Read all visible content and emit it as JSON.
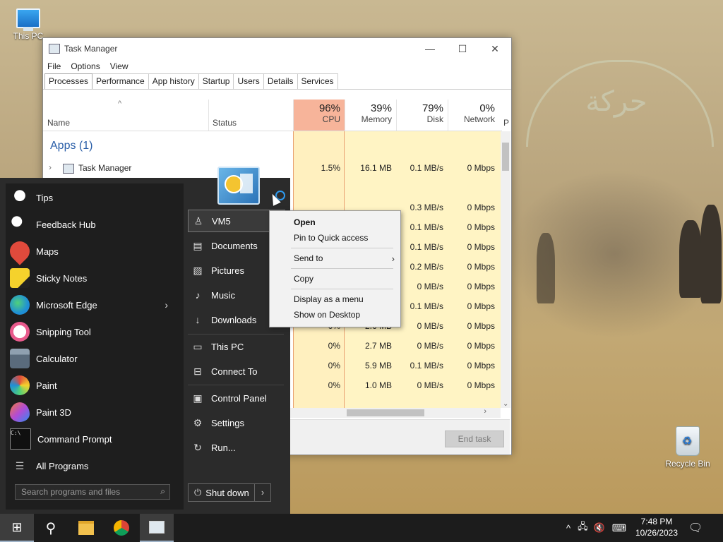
{
  "desktop": {
    "icons": [
      {
        "label": "This PC"
      },
      {
        "label": "Recycle Bin"
      }
    ]
  },
  "task_manager": {
    "title": "Task Manager",
    "menu": [
      "File",
      "Options",
      "View"
    ],
    "tabs": [
      "Processes",
      "Performance",
      "App history",
      "Startup",
      "Users",
      "Details",
      "Services"
    ],
    "columns": {
      "name": "Name",
      "status": "Status",
      "cpu": {
        "pct": "96%",
        "label": "CPU"
      },
      "memory": {
        "pct": "39%",
        "label": "Memory"
      },
      "disk": {
        "pct": "79%",
        "label": "Disk"
      },
      "network": {
        "pct": "0%",
        "label": "Network"
      },
      "partial": "P"
    },
    "apps_header": "Apps (1)",
    "rows": [
      {
        "name": "Task Manager",
        "cpu": "1.5%",
        "memory": "16.1 MB",
        "disk": "0.1 MB/s",
        "network": "0 Mbps"
      },
      {
        "name": "",
        "cpu": "",
        "memory": "",
        "disk": "",
        "network": ""
      },
      {
        "name": "",
        "cpu": "",
        "memory": "",
        "disk": "0.3 MB/s",
        "network": "0 Mbps"
      },
      {
        "name": "",
        "cpu": "",
        "memory": "",
        "disk": "0.1 MB/s",
        "network": "0 Mbps"
      },
      {
        "name": "",
        "cpu": "",
        "memory": "",
        "disk": "0.1 MB/s",
        "network": "0 Mbps"
      },
      {
        "name": "",
        "cpu": "",
        "memory": "",
        "disk": "0.2 MB/s",
        "network": "0 Mbps"
      },
      {
        "name": "",
        "cpu": "",
        "memory": "",
        "disk": "0 MB/s",
        "network": "0 Mbps"
      },
      {
        "name": "",
        "cpu": "",
        "memory": "",
        "disk": "0.1 MB/s",
        "network": "0 Mbps"
      },
      {
        "name": "",
        "cpu": "0%",
        "memory": "2.6 MB",
        "disk": "0 MB/s",
        "network": "0 Mbps"
      },
      {
        "name": "",
        "cpu": "0%",
        "memory": "2.7 MB",
        "disk": "0 MB/s",
        "network": "0 Mbps"
      },
      {
        "name": "",
        "cpu": "0%",
        "memory": "5.9 MB",
        "disk": "0.1 MB/s",
        "network": "0 Mbps"
      },
      {
        "name": "",
        "cpu": "0%",
        "memory": "1.0 MB",
        "disk": "0 MB/s",
        "network": "0 Mbps"
      }
    ],
    "end_task": "End task"
  },
  "start_menu": {
    "apps": [
      {
        "label": "Tips",
        "color": "#f4f4f4"
      },
      {
        "label": "Feedback Hub",
        "color": "#f4f4f4"
      },
      {
        "label": "Maps",
        "color": "#e04a3c"
      },
      {
        "label": "Sticky Notes",
        "color": "#f5d22c"
      },
      {
        "label": "Microsoft Edge",
        "color": "#1f8fd6"
      },
      {
        "label": "Snipping Tool",
        "color": "#e85a8c"
      },
      {
        "label": "Calculator",
        "color": "#5a6b7c"
      },
      {
        "label": "Paint",
        "color": "#e9a23b"
      },
      {
        "label": "Paint 3D",
        "color": "#b24bd6"
      },
      {
        "label": "Command Prompt",
        "color": "#101010"
      }
    ],
    "all_programs": "All Programs",
    "search_placeholder": "Search programs and files",
    "places": [
      "VM5",
      "Documents",
      "Pictures",
      "Music",
      "Downloads",
      "This PC",
      "Connect To",
      "Control Panel",
      "Settings",
      "Run..."
    ],
    "shutdown": "Shut down"
  },
  "context_menu": {
    "items": [
      "Open",
      "Pin to Quick access",
      "Send to",
      "Copy",
      "Display as a menu",
      "Show on Desktop"
    ]
  },
  "taskbar": {
    "time": "7:48 PM",
    "date": "10/26/2023"
  }
}
